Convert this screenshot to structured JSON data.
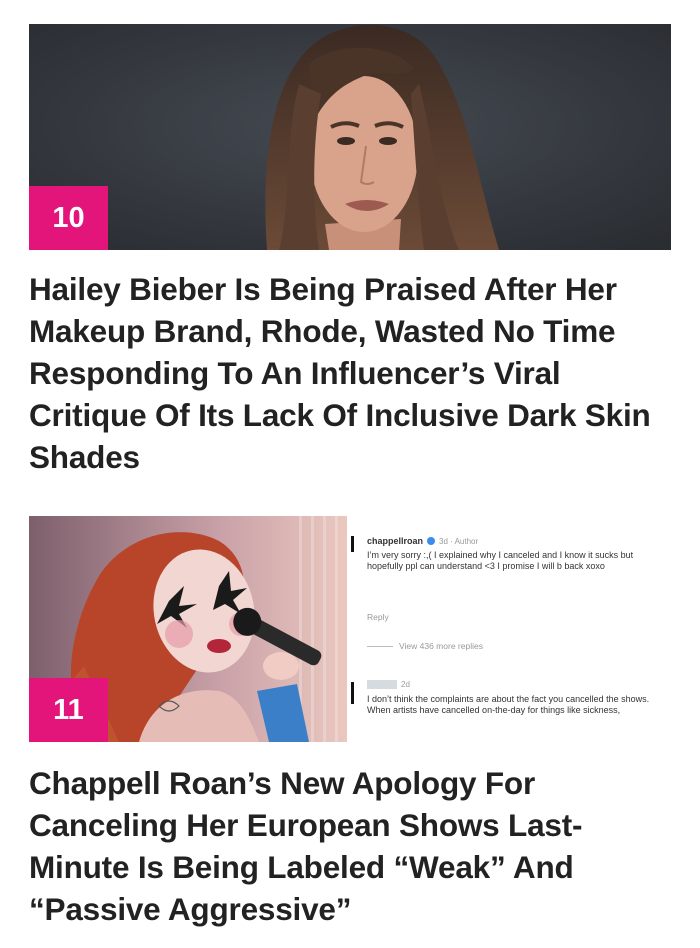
{
  "articles": [
    {
      "rank": "10",
      "title": "Hailey Bieber Is Being Praised After Her Makeup Brand, Rhode, Wasted No Time Responding To An Influencer’s Viral Critique Of Its Lack Of Inclusive Dark Skin Shades"
    },
    {
      "rank": "11",
      "title": "Chappell Roan’s New Apology For Canceling Her European Shows Last-Minute Is Being Labeled “Weak” And “Passive Aggressive”",
      "screenshot": {
        "author_name": "chappellroan",
        "author_meta": "3d · Author",
        "author_comment": "I’m very sorry :,( I explained why I canceled and I know it sucks but hopefully ppl can understand <3 I promise I will b back xoxo",
        "reply_label": "Reply",
        "view_more": "View 436 more replies",
        "other_meta": "2d",
        "other_comment": "I don’t think the complaints are about the fact you cancelled the shows. When artists have cancelled on-the-day for things like sickness,"
      }
    }
  ],
  "colors": {
    "badge": "#e4157a",
    "text": "#222222"
  }
}
